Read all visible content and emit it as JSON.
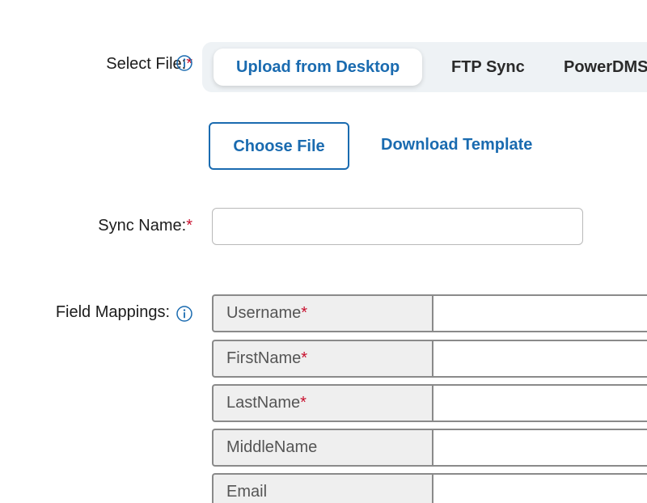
{
  "select_file": {
    "label": "Select File:",
    "required_mark": "*",
    "info_icon": "info-circle-icon"
  },
  "tabs": [
    {
      "label": "Upload from Desktop",
      "active": true
    },
    {
      "label": "FTP Sync",
      "active": false
    },
    {
      "label": "PowerDMS",
      "active": false
    }
  ],
  "actions": {
    "choose_file": "Choose File",
    "download_template": "Download Template"
  },
  "sync_name": {
    "label": "Sync Name:",
    "required_mark": "*",
    "value": "",
    "placeholder": ""
  },
  "field_mappings": {
    "label": "Field Mappings:",
    "info_icon": "info-circle-icon",
    "rows": [
      {
        "name": "Username",
        "required_mark": "*",
        "value": ""
      },
      {
        "name": "FirstName",
        "required_mark": "*",
        "value": ""
      },
      {
        "name": "LastName",
        "required_mark": "*",
        "value": ""
      },
      {
        "name": "MiddleName",
        "required_mark": "",
        "value": ""
      },
      {
        "name": "Email",
        "required_mark": "",
        "value": ""
      }
    ]
  },
  "colors": {
    "accent": "#1a6bb0",
    "required": "#c8102e",
    "tabbar_bg": "#eef2f5"
  }
}
